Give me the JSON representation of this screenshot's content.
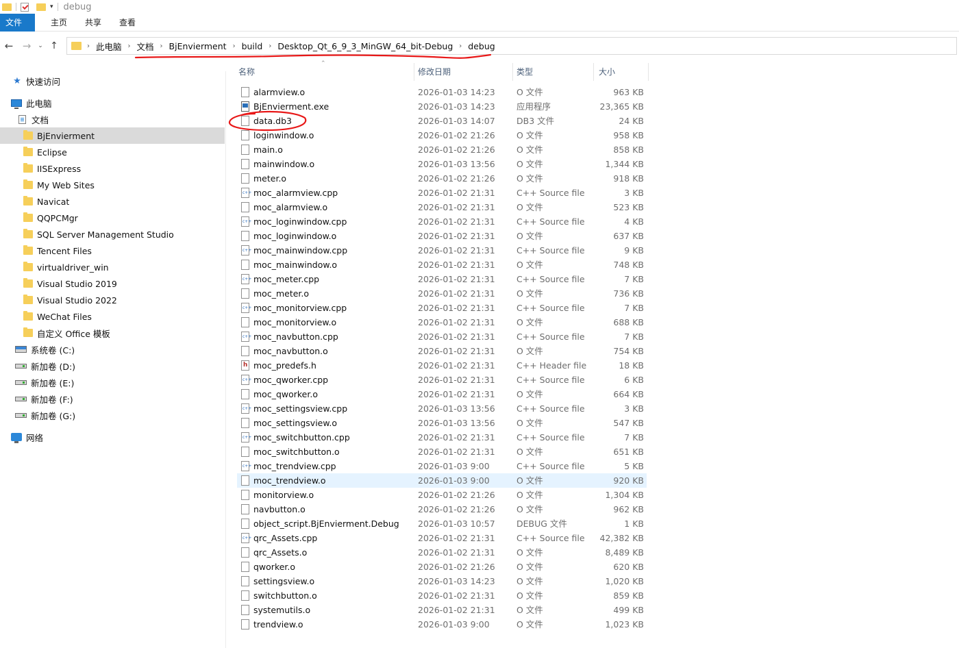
{
  "window": {
    "title": "debug"
  },
  "ribbon": {
    "tabs": [
      "文件",
      "主页",
      "共享",
      "查看"
    ]
  },
  "address": {
    "crumbs": [
      "此电脑",
      "文档",
      "BjEnvierment",
      "build",
      "Desktop_Qt_6_9_3_MinGW_64_bit-Debug",
      "debug"
    ]
  },
  "sidebar": {
    "quick_access": "快速访问",
    "this_pc": "此电脑",
    "documents": "文档",
    "folders": [
      "BjEnvierment",
      "Eclipse",
      "IISExpress",
      "My Web Sites",
      "Navicat",
      "QQPCMgr",
      "SQL Server Management Studio",
      "Tencent Files",
      "virtualdriver_win",
      "Visual Studio 2019",
      "Visual Studio 2022",
      "WeChat Files",
      "自定义 Office 模板"
    ],
    "drives": [
      "系统卷 (C:)",
      "新加卷 (D:)",
      "新加卷 (E:)",
      "新加卷 (F:)",
      "新加卷 (G:)"
    ],
    "network": "网络",
    "selected": "BjEnvierment"
  },
  "columns": {
    "name": "名称",
    "date": "修改日期",
    "type": "类型",
    "size": "大小"
  },
  "files": [
    {
      "name": "alarmview.o",
      "date": "2026-01-03 14:23",
      "type": "O 文件",
      "size": "963 KB",
      "icon": "file"
    },
    {
      "name": "BjEnvierment.exe",
      "date": "2026-01-03 14:23",
      "type": "应用程序",
      "size": "23,365 KB",
      "icon": "exe"
    },
    {
      "name": "data.db3",
      "date": "2026-01-03 14:07",
      "type": "DB3 文件",
      "size": "24 KB",
      "icon": "file"
    },
    {
      "name": "loginwindow.o",
      "date": "2026-01-02 21:26",
      "type": "O 文件",
      "size": "958 KB",
      "icon": "file"
    },
    {
      "name": "main.o",
      "date": "2026-01-02 21:26",
      "type": "O 文件",
      "size": "858 KB",
      "icon": "file"
    },
    {
      "name": "mainwindow.o",
      "date": "2026-01-03 13:56",
      "type": "O 文件",
      "size": "1,344 KB",
      "icon": "file"
    },
    {
      "name": "meter.o",
      "date": "2026-01-02 21:26",
      "type": "O 文件",
      "size": "918 KB",
      "icon": "file"
    },
    {
      "name": "moc_alarmview.cpp",
      "date": "2026-01-02 21:31",
      "type": "C++ Source file",
      "size": "3 KB",
      "icon": "cpp"
    },
    {
      "name": "moc_alarmview.o",
      "date": "2026-01-02 21:31",
      "type": "O 文件",
      "size": "523 KB",
      "icon": "file"
    },
    {
      "name": "moc_loginwindow.cpp",
      "date": "2026-01-02 21:31",
      "type": "C++ Source file",
      "size": "4 KB",
      "icon": "cpp"
    },
    {
      "name": "moc_loginwindow.o",
      "date": "2026-01-02 21:31",
      "type": "O 文件",
      "size": "637 KB",
      "icon": "file"
    },
    {
      "name": "moc_mainwindow.cpp",
      "date": "2026-01-02 21:31",
      "type": "C++ Source file",
      "size": "9 KB",
      "icon": "cpp"
    },
    {
      "name": "moc_mainwindow.o",
      "date": "2026-01-02 21:31",
      "type": "O 文件",
      "size": "748 KB",
      "icon": "file"
    },
    {
      "name": "moc_meter.cpp",
      "date": "2026-01-02 21:31",
      "type": "C++ Source file",
      "size": "7 KB",
      "icon": "cpp"
    },
    {
      "name": "moc_meter.o",
      "date": "2026-01-02 21:31",
      "type": "O 文件",
      "size": "736 KB",
      "icon": "file"
    },
    {
      "name": "moc_monitorview.cpp",
      "date": "2026-01-02 21:31",
      "type": "C++ Source file",
      "size": "7 KB",
      "icon": "cpp"
    },
    {
      "name": "moc_monitorview.o",
      "date": "2026-01-02 21:31",
      "type": "O 文件",
      "size": "688 KB",
      "icon": "file"
    },
    {
      "name": "moc_navbutton.cpp",
      "date": "2026-01-02 21:31",
      "type": "C++ Source file",
      "size": "7 KB",
      "icon": "cpp"
    },
    {
      "name": "moc_navbutton.o",
      "date": "2026-01-02 21:31",
      "type": "O 文件",
      "size": "754 KB",
      "icon": "file"
    },
    {
      "name": "moc_predefs.h",
      "date": "2026-01-02 21:31",
      "type": "C++ Header file",
      "size": "18 KB",
      "icon": "h"
    },
    {
      "name": "moc_qworker.cpp",
      "date": "2026-01-02 21:31",
      "type": "C++ Source file",
      "size": "6 KB",
      "icon": "cpp"
    },
    {
      "name": "moc_qworker.o",
      "date": "2026-01-02 21:31",
      "type": "O 文件",
      "size": "664 KB",
      "icon": "file"
    },
    {
      "name": "moc_settingsview.cpp",
      "date": "2026-01-03 13:56",
      "type": "C++ Source file",
      "size": "3 KB",
      "icon": "cpp"
    },
    {
      "name": "moc_settingsview.o",
      "date": "2026-01-03 13:56",
      "type": "O 文件",
      "size": "547 KB",
      "icon": "file"
    },
    {
      "name": "moc_switchbutton.cpp",
      "date": "2026-01-02 21:31",
      "type": "C++ Source file",
      "size": "7 KB",
      "icon": "cpp"
    },
    {
      "name": "moc_switchbutton.o",
      "date": "2026-01-02 21:31",
      "type": "O 文件",
      "size": "651 KB",
      "icon": "file"
    },
    {
      "name": "moc_trendview.cpp",
      "date": "2026-01-03 9:00",
      "type": "C++ Source file",
      "size": "5 KB",
      "icon": "cpp"
    },
    {
      "name": "moc_trendview.o",
      "date": "2026-01-03 9:00",
      "type": "O 文件",
      "size": "920 KB",
      "icon": "file",
      "hover": true
    },
    {
      "name": "monitorview.o",
      "date": "2026-01-02 21:26",
      "type": "O 文件",
      "size": "1,304 KB",
      "icon": "file"
    },
    {
      "name": "navbutton.o",
      "date": "2026-01-02 21:26",
      "type": "O 文件",
      "size": "962 KB",
      "icon": "file"
    },
    {
      "name": "object_script.BjEnvierment.Debug",
      "date": "2026-01-03 10:57",
      "type": "DEBUG 文件",
      "size": "1 KB",
      "icon": "file"
    },
    {
      "name": "qrc_Assets.cpp",
      "date": "2026-01-02 21:31",
      "type": "C++ Source file",
      "size": "42,382 KB",
      "icon": "cpp"
    },
    {
      "name": "qrc_Assets.o",
      "date": "2026-01-02 21:31",
      "type": "O 文件",
      "size": "8,489 KB",
      "icon": "file"
    },
    {
      "name": "qworker.o",
      "date": "2026-01-02 21:26",
      "type": "O 文件",
      "size": "620 KB",
      "icon": "file"
    },
    {
      "name": "settingsview.o",
      "date": "2026-01-03 14:23",
      "type": "O 文件",
      "size": "1,020 KB",
      "icon": "file"
    },
    {
      "name": "switchbutton.o",
      "date": "2026-01-02 21:31",
      "type": "O 文件",
      "size": "859 KB",
      "icon": "file"
    },
    {
      "name": "systemutils.o",
      "date": "2026-01-02 21:31",
      "type": "O 文件",
      "size": "499 KB",
      "icon": "file"
    },
    {
      "name": "trendview.o",
      "date": "2026-01-03 9:00",
      "type": "O 文件",
      "size": "1,023 KB",
      "icon": "file"
    }
  ],
  "colors": {
    "accent": "#1979ca",
    "annotation": "#e81818",
    "hover_row": "#e5f3ff",
    "selected_sidebar": "#dadada"
  },
  "icons": [
    "folder-icon",
    "check-icon",
    "back-icon",
    "forward-icon",
    "up-icon",
    "file-icon",
    "cpp-file-icon",
    "header-file-icon",
    "exe-icon",
    "drive-icon",
    "network-icon"
  ]
}
